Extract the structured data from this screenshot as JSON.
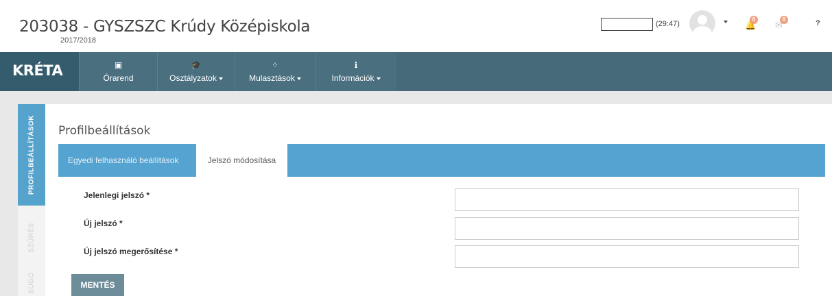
{
  "header": {
    "school_title": "203038 - GYSZSZC Krúdy Középiskola",
    "school_year": "2017/2018",
    "session_timer": "(29:47)",
    "notifications_count": "0",
    "messages_count": "0",
    "help_label": "?",
    "icons": {
      "avatar": "user-avatar-icon",
      "bell": "bell-icon",
      "mail": "envelope-icon"
    }
  },
  "navbar": {
    "logo": "KRÉTA",
    "items": [
      {
        "label": "Órarend",
        "icon": "▣",
        "icon_name": "calendar-icon",
        "has_dropdown": false
      },
      {
        "label": "Osztályzatok",
        "icon": "🎓",
        "icon_name": "graduation-cap-icon",
        "has_dropdown": true
      },
      {
        "label": "Mulasztások",
        "icon": "⁘",
        "icon_name": "spinner-icon",
        "has_dropdown": true
      },
      {
        "label": "Információk",
        "icon": "ℹ",
        "icon_name": "info-icon",
        "has_dropdown": true
      }
    ]
  },
  "side_tabs": [
    {
      "label": "PROFILBEÁLLÍTÁSOK",
      "active": true
    },
    {
      "label": "SZŰRÉS",
      "active": false
    },
    {
      "label": "SÚGÓ",
      "active": false
    }
  ],
  "main": {
    "title": "Profilbeállítások",
    "tabs": [
      {
        "label": "Egyedi felhasználó beállítások",
        "active": false
      },
      {
        "label": "Jelszó módosítása",
        "active": true
      }
    ],
    "form": {
      "fields": [
        {
          "label": "Jelenlegi jelszó *",
          "value": ""
        },
        {
          "label": "Új jelszó *",
          "value": ""
        },
        {
          "label": "Új jelszó megerősítése *",
          "value": ""
        }
      ],
      "save_label": "MENTÉS"
    }
  },
  "colors": {
    "navbar": "#4a6f7f",
    "accent_blue": "#54a3d0",
    "badge": "#f0a080",
    "save_button": "#6c8c99"
  }
}
